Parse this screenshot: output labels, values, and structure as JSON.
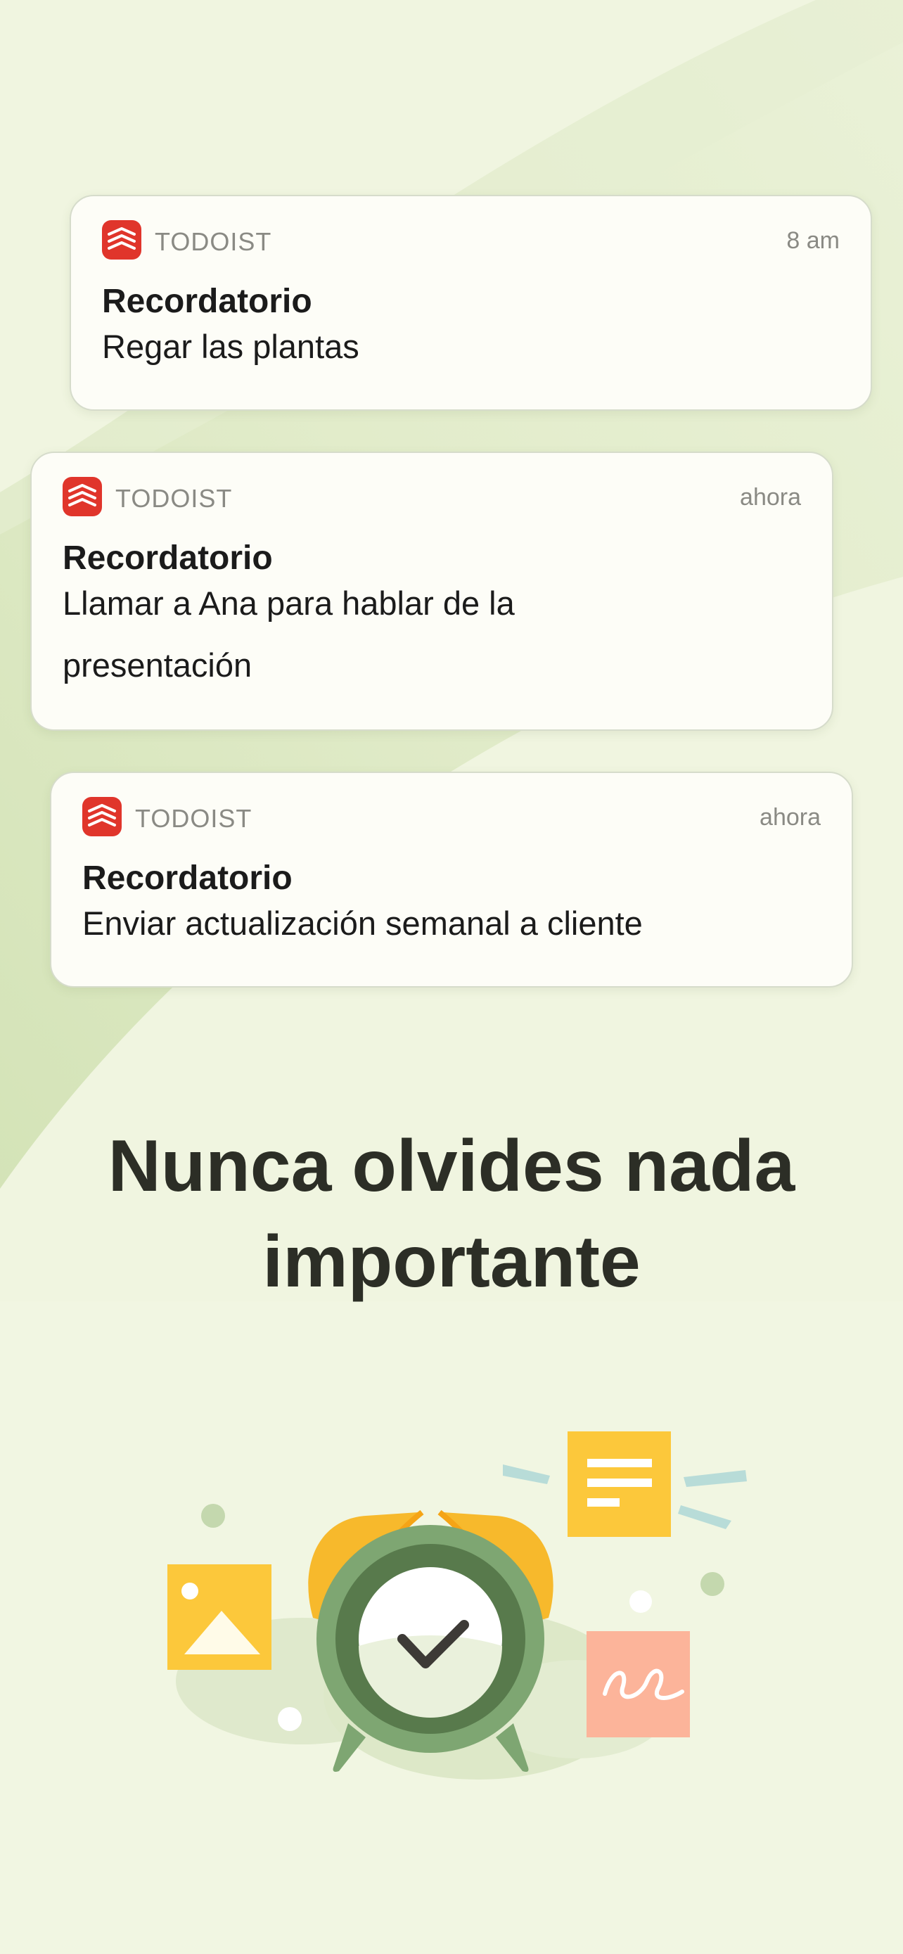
{
  "notifications": [
    {
      "app_name": "TODOIST",
      "time": "8 am",
      "title": "Recordatorio",
      "body": "Regar las plantas"
    },
    {
      "app_name": "TODOIST",
      "time": "ahora",
      "title": "Recordatorio",
      "body": "Llamar a Ana para hablar de la presentación"
    },
    {
      "app_name": "TODOIST",
      "time": "ahora",
      "title": "Recordatorio",
      "body": "Enviar actualización semanal a cliente"
    }
  ],
  "headline": {
    "line1": "Nunca olvides nada",
    "line2": "importante"
  },
  "icons": {
    "app_icon": "todoist-logo-icon",
    "illustration": "alarm-clock-illustration"
  },
  "colors": {
    "background": "#eef4dc",
    "card": "#fdfdf7",
    "brand_red": "#e0352b",
    "headline": "#2c2e26",
    "clock_green": "#6e9a62",
    "bell_yellow": "#f7b92c",
    "note_yellow": "#fcc83b",
    "note_salmon": "#fcb49a"
  }
}
